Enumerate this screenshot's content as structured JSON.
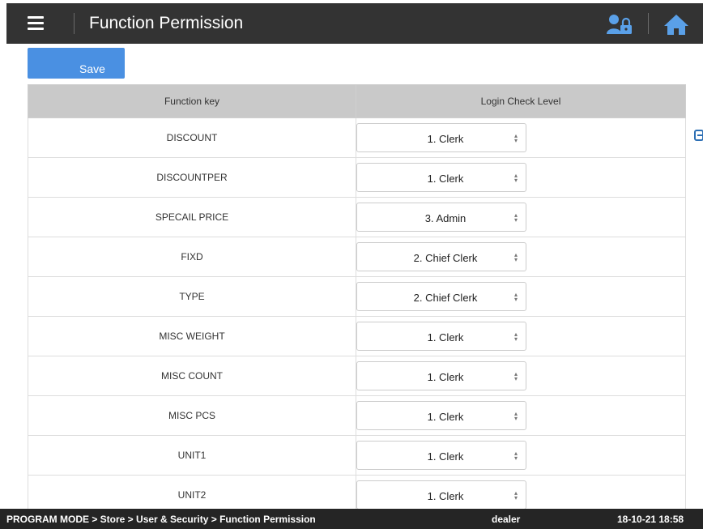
{
  "header": {
    "title": "Function Permission"
  },
  "toolbar": {
    "save_label": "Save"
  },
  "table": {
    "columns": [
      "Function key",
      "Login Check Level"
    ],
    "rows": [
      {
        "key": "DISCOUNT",
        "level": "1. Clerk"
      },
      {
        "key": "DISCOUNTPER",
        "level": "1. Clerk"
      },
      {
        "key": "SPECAIL PRICE",
        "level": "3. Admin"
      },
      {
        "key": "FIXD",
        "level": "2. Chief Clerk"
      },
      {
        "key": "TYPE",
        "level": "2. Chief Clerk"
      },
      {
        "key": "MISC WEIGHT",
        "level": "1. Clerk"
      },
      {
        "key": "MISC COUNT",
        "level": "1. Clerk"
      },
      {
        "key": "MISC PCS",
        "level": "1. Clerk"
      },
      {
        "key": "UNIT1",
        "level": "1. Clerk"
      },
      {
        "key": "UNIT2",
        "level": "1. Clerk"
      }
    ]
  },
  "status": {
    "breadcrumb": "PROGRAM MODE > Store > User & Security > Function Permission",
    "user": "dealer",
    "datetime": "18-10-21 18:58"
  },
  "icons": {
    "menu": "menu-icon",
    "user_lock": "user-lock-icon",
    "home": "home-icon",
    "edge": "logout-icon"
  },
  "colors": {
    "header_bg": "#333333",
    "accent": "#4a90e2",
    "status_bg": "#252525",
    "table_header_bg": "#c9c9c9"
  }
}
